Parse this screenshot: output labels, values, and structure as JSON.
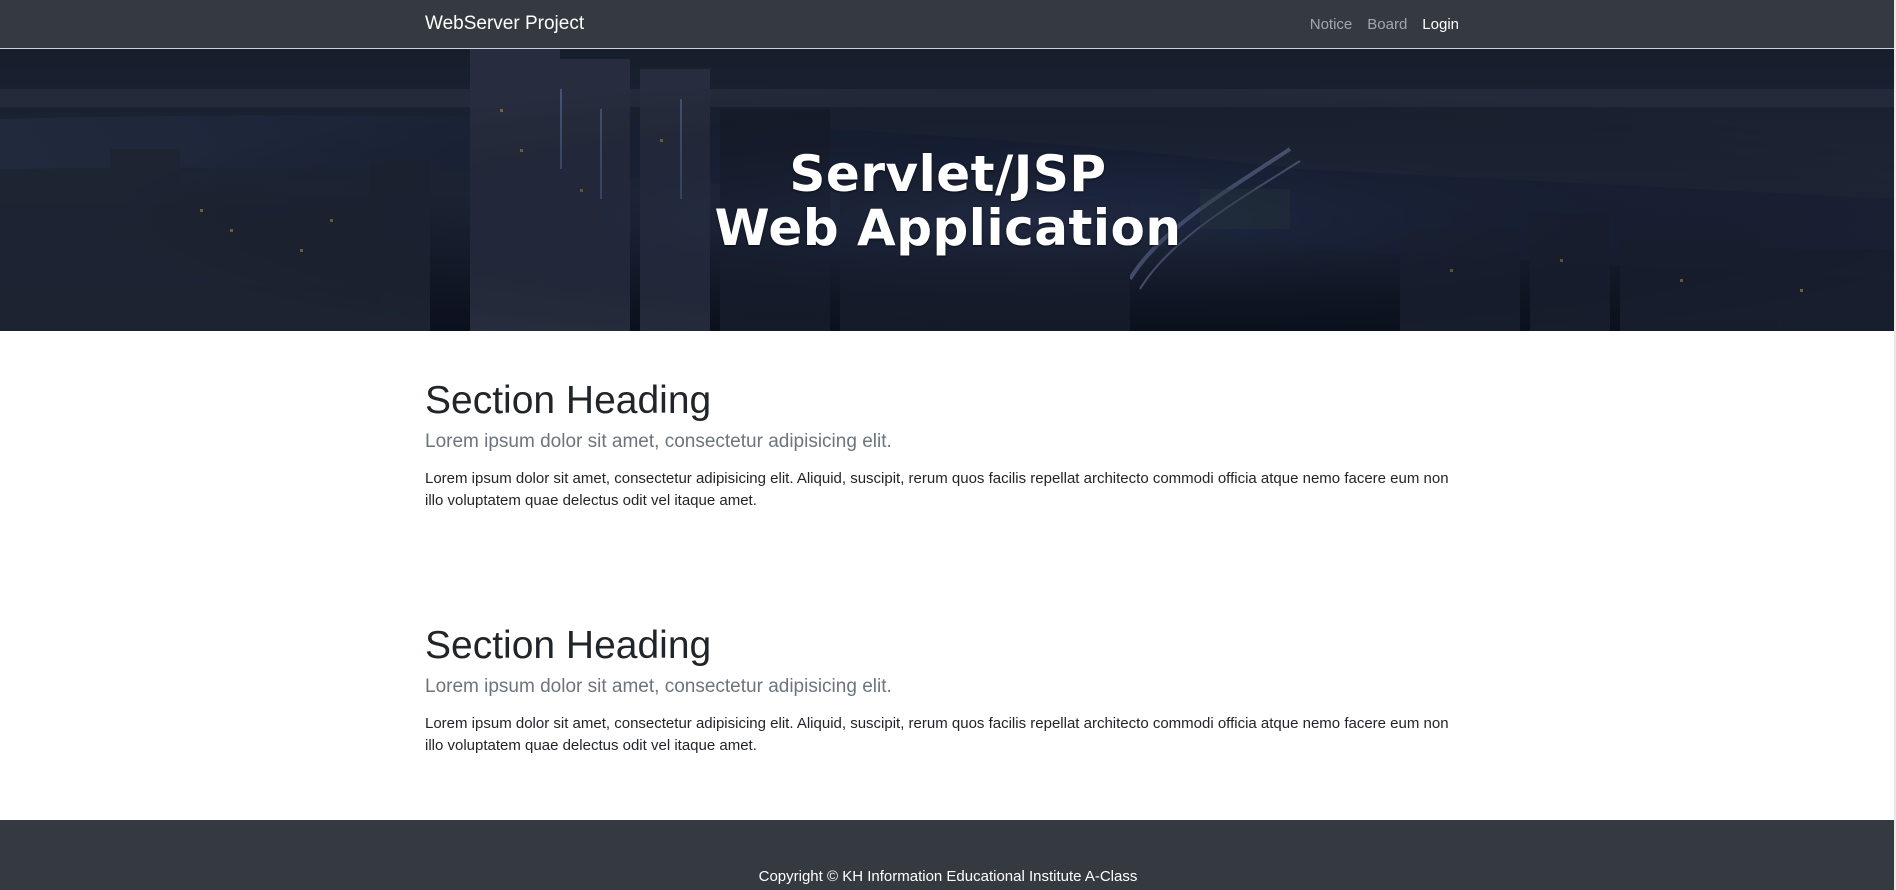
{
  "navbar": {
    "brand": "WebServer Project",
    "links": [
      {
        "label": "Notice"
      },
      {
        "label": "Board"
      },
      {
        "label": "Login"
      }
    ]
  },
  "hero": {
    "title_line1": "Servlet/JSP",
    "title_line2": "Web Application"
  },
  "sections": [
    {
      "heading": "Section Heading",
      "lead": "Lorem ipsum dolor sit amet, consectetur adipisicing elit.",
      "body": "Lorem ipsum dolor sit amet, consectetur adipisicing elit. Aliquid, suscipit, rerum quos facilis repellat architecto commodi officia atque nemo facere eum non illo voluptatem quae delectus odit vel itaque amet."
    },
    {
      "heading": "Section Heading",
      "lead": "Lorem ipsum dolor sit amet, consectetur adipisicing elit.",
      "body": "Lorem ipsum dolor sit amet, consectetur adipisicing elit. Aliquid, suscipit, rerum quos facilis repellat architecto commodi officia atque nemo facere eum non illo voluptatem quae delectus odit vel itaque amet."
    }
  ],
  "footer": {
    "copyright": "Copyright © KH Information Educational Institute A-Class"
  },
  "colors": {
    "navbar_bg": "#343a40",
    "footer_bg": "#343a40",
    "hero_overlay": "#141a2a"
  }
}
